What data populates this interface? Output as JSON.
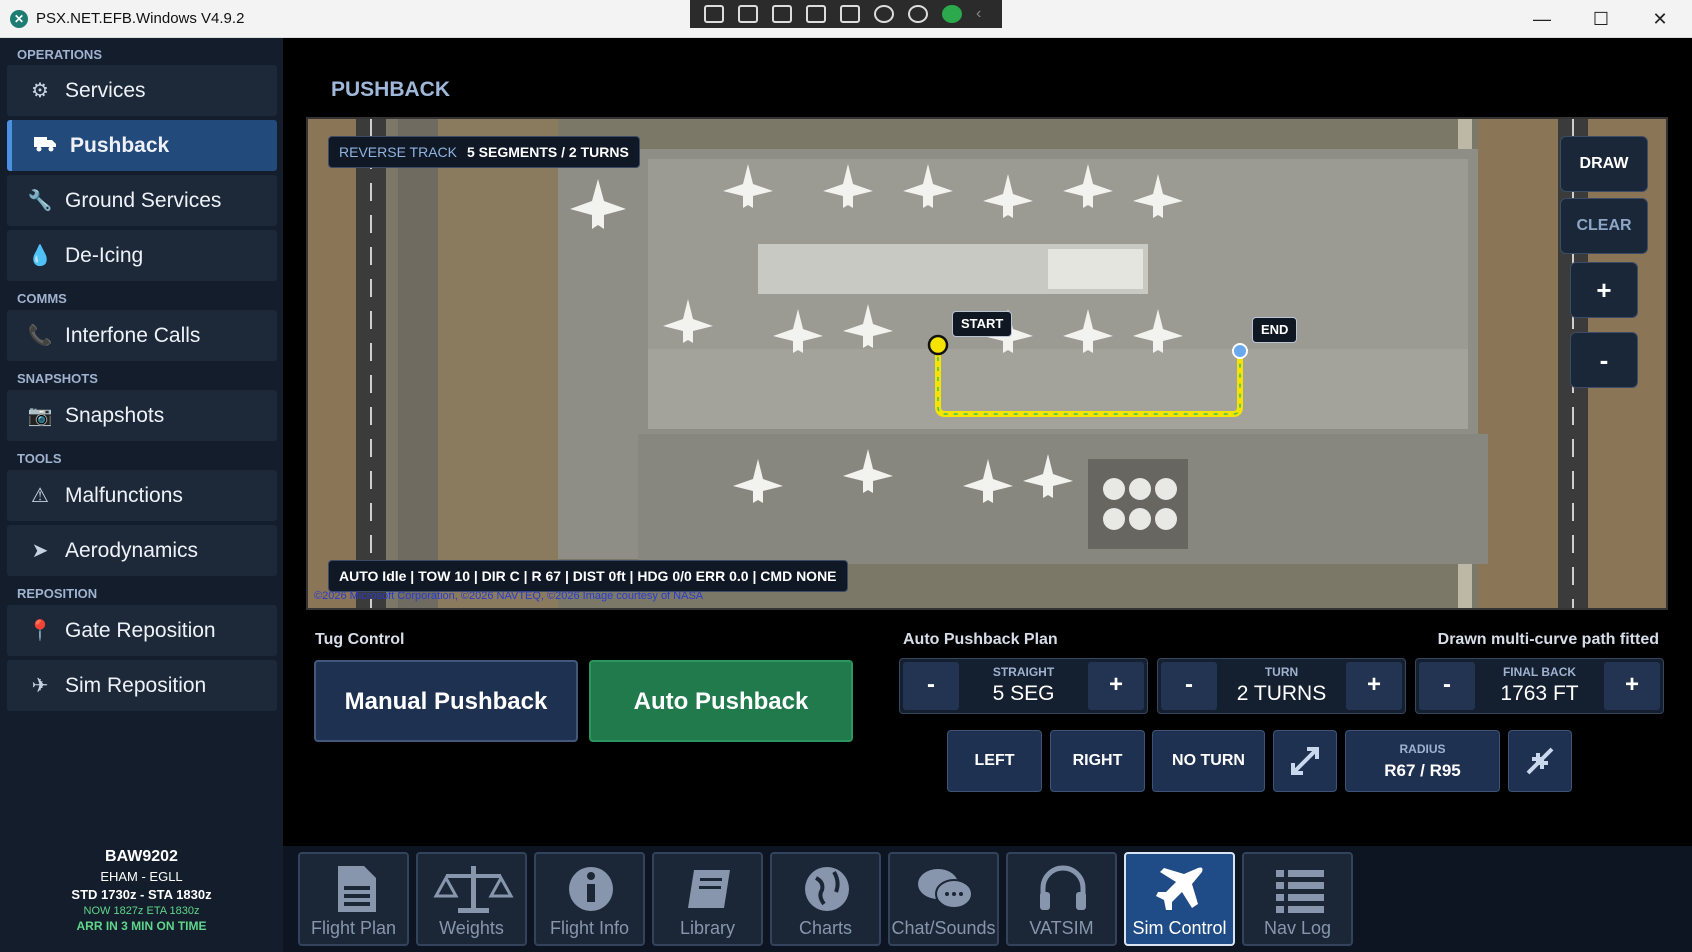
{
  "window": {
    "title": "PSX.NET.EFB.Windows V4.9.2"
  },
  "sidebar": {
    "sections": [
      {
        "header": "OPERATIONS",
        "items": [
          {
            "label": "Services",
            "icon": "gear-icon"
          },
          {
            "label": "Pushback",
            "icon": "truck-icon",
            "active": true
          },
          {
            "label": "Ground Services",
            "icon": "wrench-icon"
          },
          {
            "label": "De-Icing",
            "icon": "droplet-icon"
          }
        ]
      },
      {
        "header": "COMMS",
        "items": [
          {
            "label": "Interfone Calls",
            "icon": "phone-icon"
          }
        ]
      },
      {
        "header": "SNAPSHOTS",
        "items": [
          {
            "label": "Snapshots",
            "icon": "camera-icon"
          }
        ]
      },
      {
        "header": "TOOLS",
        "items": [
          {
            "label": "Malfunctions",
            "icon": "warning-icon"
          },
          {
            "label": "Aerodynamics",
            "icon": "paper-plane-icon"
          }
        ]
      },
      {
        "header": "REPOSITION",
        "items": [
          {
            "label": "Gate Reposition",
            "icon": "map-pin-icon"
          },
          {
            "label": "Sim Reposition",
            "icon": "plane-icon"
          }
        ]
      }
    ]
  },
  "flight": {
    "callsign": "BAW9202",
    "route": "EHAM  -  EGLL",
    "times": "STD 1730z  -  STA 1830z",
    "now_eta": "NOW 1827z   ETA 1830z",
    "arrival_status": "ARR IN 3 MIN  ON TIME"
  },
  "page": {
    "title": "PUSHBACK"
  },
  "map": {
    "track_label": "REVERSE TRACK",
    "track_value": "5 SEGMENTS / 2 TURNS",
    "status": "AUTO Idle | TOW 10 | DIR C | R 67 | DIST 0ft | HDG 0/0 ERR 0.0 | CMD NONE",
    "attribution": "©2026 Microsoft Corporation, ©2026 NAVTEQ, ©2026 Image courtesy of NASA",
    "start_label": "START",
    "end_label": "END",
    "draw_label": "DRAW",
    "clear_label": "CLEAR",
    "zoom_in_label": "+",
    "zoom_out_label": "-",
    "path_color": "#f5e400"
  },
  "tug": {
    "section_label": "Tug Control",
    "manual_label": "Manual Pushback",
    "auto_label": "Auto Pushback"
  },
  "plan": {
    "section_label": "Auto Pushback Plan",
    "note": "Drawn multi-curve path fitted",
    "straight": {
      "caption": "STRAIGHT",
      "value": "5 SEG"
    },
    "turn": {
      "caption": "TURN",
      "value": "2 TURNS"
    },
    "final_back": {
      "caption": "FINAL BACK",
      "value": "1763 FT"
    },
    "minus_label": "-",
    "plus_label": "+",
    "left_label": "LEFT",
    "right_label": "RIGHT",
    "no_turn_label": "NO TURN",
    "radius_caption": "RADIUS",
    "radius_value": "R67 / R95"
  },
  "tabs": [
    {
      "label": "Flight Plan",
      "icon": "document-icon"
    },
    {
      "label": "Weights",
      "icon": "scale-icon"
    },
    {
      "label": "Flight Info",
      "icon": "info-icon"
    },
    {
      "label": "Library",
      "icon": "book-icon"
    },
    {
      "label": "Charts",
      "icon": "globe-icon"
    },
    {
      "label": "Chat/Sounds",
      "icon": "chat-icon"
    },
    {
      "label": "VATSIM",
      "icon": "headset-icon"
    },
    {
      "label": "Sim Control",
      "icon": "plane-icon",
      "active": true
    },
    {
      "label": "Nav Log",
      "icon": "list-icon"
    }
  ]
}
